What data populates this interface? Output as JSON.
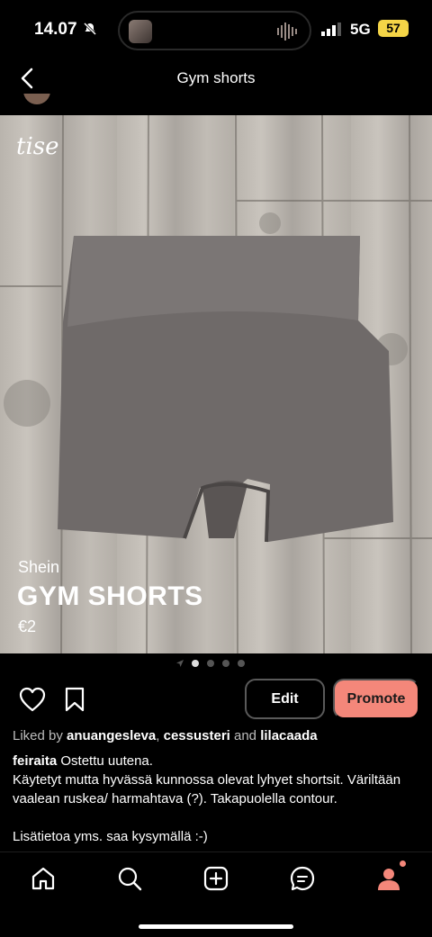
{
  "status_bar": {
    "time": "14.07",
    "network": "5G",
    "battery": "57"
  },
  "header": {
    "title": "Gym shorts"
  },
  "image": {
    "watermark": "tise",
    "brand": "Shein",
    "title": "GYM SHORTS",
    "price": "€2",
    "page_count": 4,
    "current_page": 1
  },
  "actions": {
    "edit_label": "Edit",
    "promote_label": "Promote"
  },
  "likes": {
    "prefix": "Liked by",
    "user1": "anuangesleva",
    "user2": "cessusteri",
    "conjunction": "and",
    "user3": "lilacaada"
  },
  "description": {
    "author": "feiraita",
    "line1": "Ostettu uutena.",
    "line2": "Käytetyt mutta hyvässä kunnossa olevat lyhyet shortsit. Väriltään vaalean ruskea/ harmahtava (?). Takapuolella contour.",
    "line3": "Lisätietoa yms. saa kysymällä :-)"
  },
  "bottom_nav": {
    "items": [
      "home-icon",
      "search-icon",
      "add-icon",
      "chat-icon",
      "profile-icon"
    ]
  },
  "colors": {
    "accent": "#f4877a",
    "battery": "#f5d547"
  }
}
